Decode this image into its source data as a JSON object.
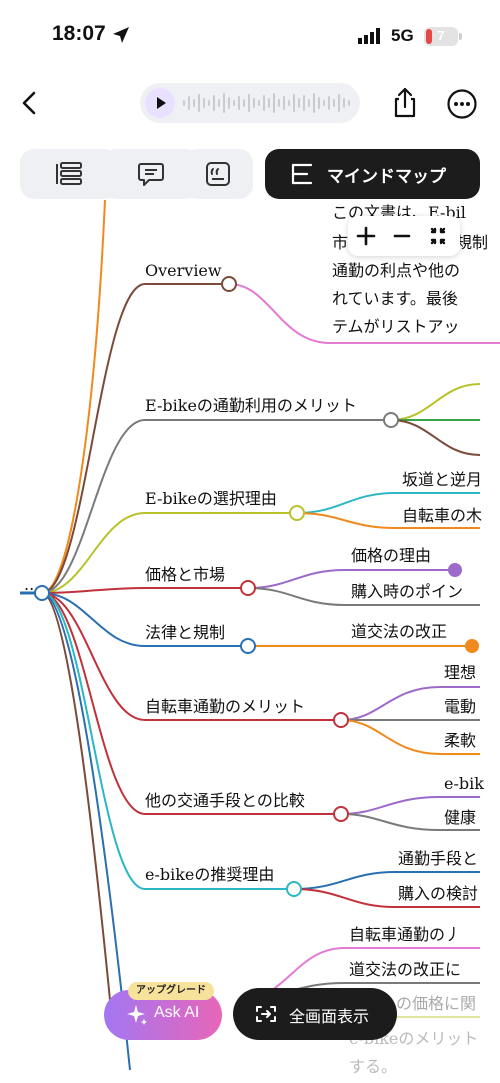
{
  "status_bar": {
    "time": "18:07",
    "network": "5G",
    "battery": "7"
  },
  "tabs": {
    "mindmap_label": "マインドマップ"
  },
  "mindmap": {
    "summary_lines": [
      "この文書は、E-bil",
      "市",
      "規制",
      "通勤の利点や他の",
      "れています。最後",
      "テムがリストアッ"
    ],
    "root_label": "..",
    "topics": [
      {
        "label": "Overview",
        "color": "#7a4a3a"
      },
      {
        "label": "E-bikeの通勤利用のメリット",
        "color": "#7a7a7a"
      },
      {
        "label": "E-bikeの選択理由",
        "color": "#b8c22a"
      },
      {
        "label": "価格と市場",
        "color": "#c0313a"
      },
      {
        "label": "法律と規制",
        "color": "#2a6fb0"
      },
      {
        "label": "自転車通勤のメリット",
        "color": "#c0313a"
      },
      {
        "label": "他の交通手段との比較",
        "color": "#c0313a"
      },
      {
        "label": "e-bikeの推奨理由",
        "color": "#2bb7c4"
      }
    ],
    "subtopics": [
      "坂道と逆月",
      "自転車の木",
      "価格の理由",
      "購入時のポイン",
      "道交法の改正",
      "理想",
      "電動",
      "柔軟",
      "e-bik",
      "健康",
      "通勤手段と",
      "購入の検討",
      "自転車通勤の丿",
      "道交法の改正に",
      "の価格に関",
      "e-bikeのメリット",
      "する。"
    ]
  },
  "buttons": {
    "ask_ai": "Ask AI",
    "upgrade": "アップグレード",
    "fullscreen": "全画面表示"
  }
}
